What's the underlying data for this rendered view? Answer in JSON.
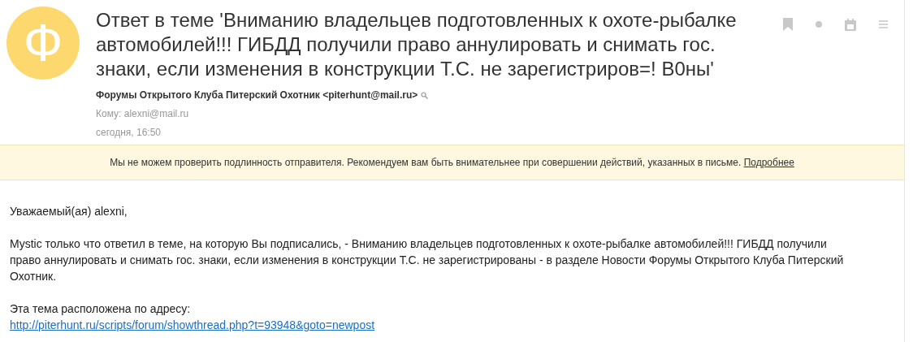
{
  "avatar": {
    "letter": "Ф",
    "color": "#fcd86f"
  },
  "subject": "Ответ в теме 'Вниманию владельцев подготовленных к охоте-рыбалке автомобилей!!! ГИБДД получили право аннулировать и снимать гос. знаки, если изменения в конструкции Т.С. не зарегистриров=! В0ны'",
  "sender": "Форумы Открытого Клуба Питерский Охотник <piterhunt@mail.ru>",
  "to": "Кому: alexni@mail.ru",
  "date": "сегодня, 16:50",
  "warning": {
    "text": "Мы не можем проверить подлинность отправителя. Рекомендуем вам быть внимательнее при совершении действий, указанных в письме.",
    "link": "Подробнее"
  },
  "body": {
    "greeting": "Уважаемый(ая) alexni,",
    "message": "Mystic только что ответил в теме, на которую Вы подписались, - Вниманию владельцев подготовленных к охоте-рыбалке автомобилей!!! ГИБДД получили право аннулировать и снимать гос. знаки, если изменения в конструкции Т.С. не зарегистрированы - в разделе Новости Форумы Открытого Клуба Питерский Охотник.",
    "address_label": "Эта тема расположена по адресу:",
    "link": "http://piterhunt.ru/scripts/forum/showthread.php?t=93948&goto=newpost"
  }
}
